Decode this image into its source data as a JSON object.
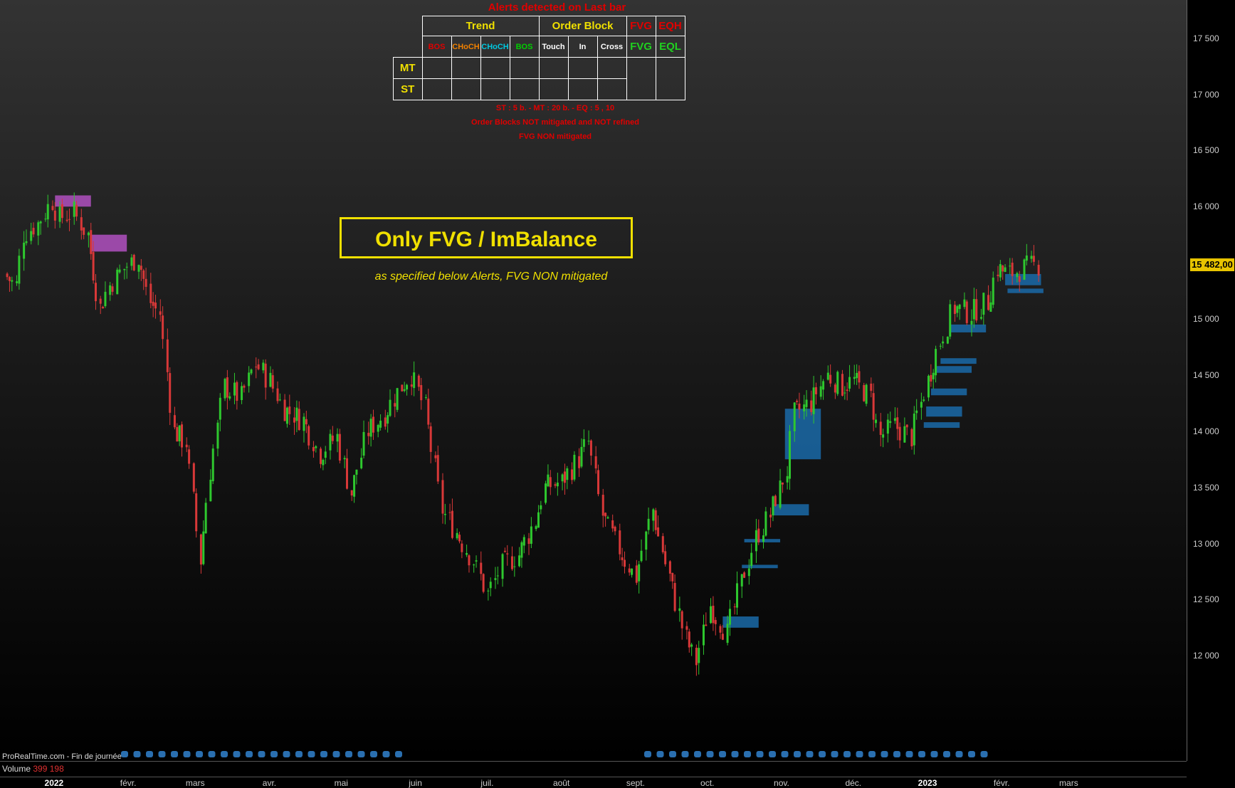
{
  "alerts": {
    "title": "Alerts detected on Last bar",
    "trend_header": "Trend",
    "orderblock_header": "Order Block",
    "fvg_red": "FVG",
    "eqh": "EQH",
    "fvg_green": "FVG",
    "eql": "EQL",
    "columns": [
      "BOS",
      "CHoCH",
      "CHoCH",
      "BOS",
      "Touch",
      "In",
      "Cross"
    ],
    "column_colors": [
      "#e00000",
      "#f08000",
      "#00c8e0",
      "#00d000",
      "#ffffff",
      "#ffffff",
      "#ffffff"
    ],
    "rows": [
      "MT",
      "ST"
    ],
    "note_params": "ST : 5 b. - MT : 20 b. - EQ : 5 , 10",
    "note_orderblocks": "Order Blocks NOT mitigated and NOT refined",
    "note_fvg": "FVG NON mitigated"
  },
  "title": "Only FVG / ImBalance",
  "subtitle": "as specified below Alerts, FVG NON mitigated",
  "footer": "ProRealTime.com - Fin de journée",
  "volume": {
    "label": "Volume",
    "value": "399 198"
  },
  "last_price": "15 482,00",
  "chart_data": {
    "type": "candlestick",
    "title": "Only FVG / ImBalance",
    "ylim": [
      11450,
      17650
    ],
    "y_ticks": [
      "17 500",
      "17 000",
      "16 500",
      "16 000",
      "15 000",
      "14 500",
      "14 000",
      "13 500",
      "13 000",
      "12 500",
      "12 000"
    ],
    "y_tick_values": [
      17500,
      17000,
      16500,
      16000,
      15000,
      14500,
      14000,
      13500,
      13000,
      12500,
      12000
    ],
    "x_ticks": [
      {
        "label": "2022",
        "bold": true,
        "date": "2022-01-01"
      },
      {
        "label": "févr.",
        "date": "2022-02-01"
      },
      {
        "label": "mars",
        "date": "2022-03-01"
      },
      {
        "label": "avr.",
        "date": "2022-04-01"
      },
      {
        "label": "mai",
        "date": "2022-05-01"
      },
      {
        "label": "juin",
        "date": "2022-06-01"
      },
      {
        "label": "juil.",
        "date": "2022-07-01"
      },
      {
        "label": "août",
        "date": "2022-08-01"
      },
      {
        "label": "sept.",
        "date": "2022-09-01"
      },
      {
        "label": "oct.",
        "date": "2022-10-01"
      },
      {
        "label": "nov.",
        "date": "2022-11-01"
      },
      {
        "label": "déc.",
        "date": "2022-12-01"
      },
      {
        "label": "2023",
        "bold": true,
        "date": "2023-01-01"
      },
      {
        "label": "févr.",
        "date": "2023-02-01"
      },
      {
        "label": "mars",
        "date": "2023-03-01"
      }
    ],
    "series": [
      {
        "values": [
          [
            "2021-12-15",
            15400
          ],
          [
            "2021-12-20",
            15300
          ],
          [
            "2021-12-23",
            15750
          ],
          [
            "2021-12-29",
            15850
          ],
          [
            "2022-01-04",
            16050
          ],
          [
            "2022-01-07",
            15900
          ],
          [
            "2022-01-13",
            15950
          ],
          [
            "2022-01-19",
            15750
          ],
          [
            "2022-01-24",
            15100
          ],
          [
            "2022-01-28",
            15300
          ],
          [
            "2022-02-03",
            15450
          ],
          [
            "2022-02-09",
            15550
          ],
          [
            "2022-02-14",
            15150
          ],
          [
            "2022-02-18",
            15050
          ],
          [
            "2022-02-24",
            14000
          ],
          [
            "2022-03-01",
            13900
          ],
          [
            "2022-03-07",
            12850
          ],
          [
            "2022-03-11",
            13650
          ],
          [
            "2022-03-17",
            14400
          ],
          [
            "2022-03-24",
            14300
          ],
          [
            "2022-03-30",
            14600
          ],
          [
            "2022-04-05",
            14450
          ],
          [
            "2022-04-11",
            14200
          ],
          [
            "2022-04-19",
            14100
          ],
          [
            "2022-04-26",
            13800
          ],
          [
            "2022-05-03",
            13950
          ],
          [
            "2022-05-09",
            13450
          ],
          [
            "2022-05-16",
            14000
          ],
          [
            "2022-05-23",
            14150
          ],
          [
            "2022-05-30",
            14400
          ],
          [
            "2022-06-03",
            14500
          ],
          [
            "2022-06-09",
            14200
          ],
          [
            "2022-06-16",
            13300
          ],
          [
            "2022-06-22",
            13100
          ],
          [
            "2022-06-29",
            12850
          ],
          [
            "2022-07-05",
            12550
          ],
          [
            "2022-07-11",
            12800
          ],
          [
            "2022-07-18",
            12900
          ],
          [
            "2022-07-25",
            13200
          ],
          [
            "2022-07-29",
            13500
          ],
          [
            "2022-08-05",
            13550
          ],
          [
            "2022-08-12",
            13750
          ],
          [
            "2022-08-16",
            13900
          ],
          [
            "2022-08-22",
            13250
          ],
          [
            "2022-08-29",
            12950
          ],
          [
            "2022-09-05",
            12700
          ],
          [
            "2022-09-12",
            13300
          ],
          [
            "2022-09-19",
            12700
          ],
          [
            "2022-09-26",
            12150
          ],
          [
            "2022-09-30",
            11950
          ],
          [
            "2022-10-06",
            12450
          ],
          [
            "2022-10-13",
            12200
          ],
          [
            "2022-10-19",
            12650
          ],
          [
            "2022-10-25",
            13050
          ],
          [
            "2022-10-31",
            13250
          ],
          [
            "2022-11-07",
            13650
          ],
          [
            "2022-11-10",
            14150
          ],
          [
            "2022-11-17",
            14250
          ],
          [
            "2022-11-24",
            14500
          ],
          [
            "2022-11-30",
            14400
          ],
          [
            "2022-12-05",
            14450
          ],
          [
            "2022-12-12",
            14300
          ],
          [
            "2022-12-16",
            13950
          ],
          [
            "2022-12-22",
            14050
          ],
          [
            "2022-12-29",
            13950
          ],
          [
            "2023-01-05",
            14450
          ],
          [
            "2023-01-10",
            14800
          ],
          [
            "2023-01-16",
            15100
          ],
          [
            "2023-01-23",
            15050
          ],
          [
            "2023-01-30",
            15150
          ],
          [
            "2023-02-03",
            15450
          ],
          [
            "2023-02-08",
            15400
          ],
          [
            "2023-02-14",
            15450
          ],
          [
            "2023-02-20",
            15482
          ]
        ]
      }
    ],
    "fvg_zones": [
      {
        "start": "2022-01-05",
        "end": "2022-01-20",
        "top": 16100,
        "bottom": 16000,
        "color": "#b050c0"
      },
      {
        "start": "2022-01-20",
        "end": "2022-02-04",
        "top": 15750,
        "bottom": 15600,
        "color": "#b050c0"
      },
      {
        "start": "2022-10-11",
        "end": "2022-10-26",
        "top": 12350,
        "bottom": 12250,
        "color": "#1a6aa8"
      },
      {
        "start": "2022-10-19",
        "end": "2022-11-03",
        "top": 12810,
        "bottom": 12780,
        "color": "#1a6aa8"
      },
      {
        "start": "2022-10-20",
        "end": "2022-11-04",
        "top": 13040,
        "bottom": 13010,
        "color": "#1a6aa8"
      },
      {
        "start": "2022-11-01",
        "end": "2022-11-16",
        "top": 13350,
        "bottom": 13250,
        "color": "#1a6aa8"
      },
      {
        "start": "2022-11-06",
        "end": "2022-11-21",
        "top": 14200,
        "bottom": 13750,
        "color": "#1a6aa8"
      },
      {
        "start": "2023-01-03",
        "end": "2023-01-18",
        "top": 14080,
        "bottom": 14030,
        "color": "#1a6aa8"
      },
      {
        "start": "2023-01-04",
        "end": "2023-01-19",
        "top": 14220,
        "bottom": 14130,
        "color": "#1a6aa8"
      },
      {
        "start": "2023-01-06",
        "end": "2023-01-21",
        "top": 14380,
        "bottom": 14320,
        "color": "#1a6aa8"
      },
      {
        "start": "2023-01-08",
        "end": "2023-01-23",
        "top": 14580,
        "bottom": 14520,
        "color": "#1a6aa8"
      },
      {
        "start": "2023-01-10",
        "end": "2023-01-25",
        "top": 14650,
        "bottom": 14600,
        "color": "#1a6aa8"
      },
      {
        "start": "2023-01-14",
        "end": "2023-01-29",
        "top": 14950,
        "bottom": 14880,
        "color": "#1a6aa8"
      },
      {
        "start": "2023-02-06",
        "end": "2023-02-21",
        "top": 15400,
        "bottom": 15300,
        "color": "#1a6aa8"
      },
      {
        "start": "2023-02-07",
        "end": "2023-02-22",
        "top": 15270,
        "bottom": 15230,
        "color": "#1a6aa8"
      }
    ],
    "colors": {
      "up": "#2ec82e",
      "down": "#d83838"
    }
  }
}
